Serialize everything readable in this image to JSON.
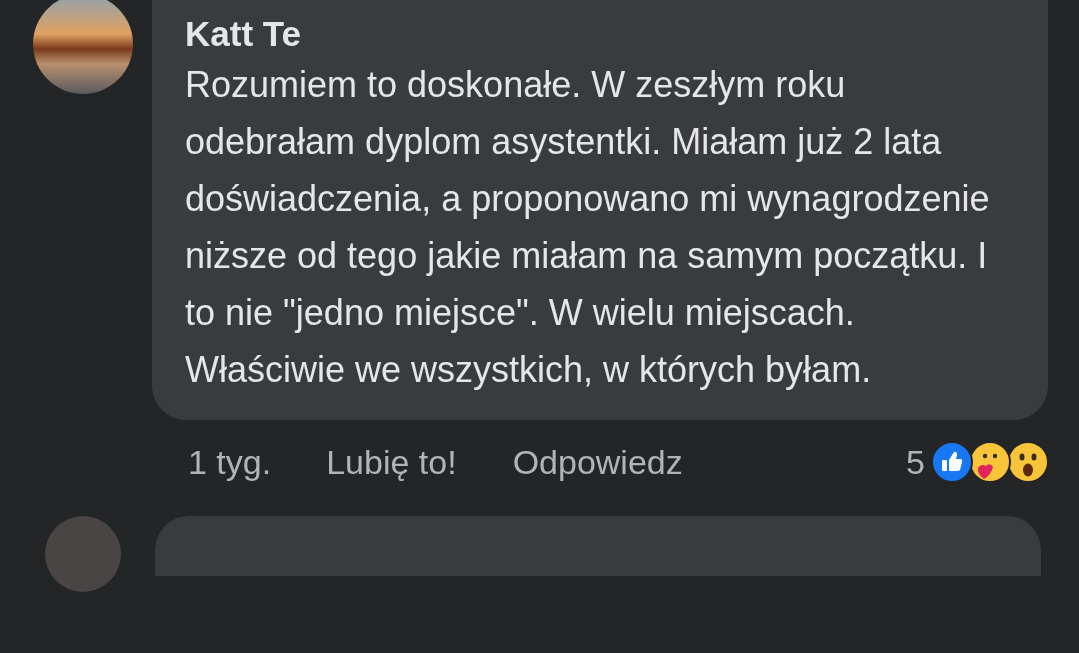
{
  "comment": {
    "author": "Katt Te",
    "text": "Rozumiem to doskonałe. W zeszłym roku odebrałam dyplom asystentki. Miałam już 2 lata doświadczenia, a proponowano mi wynagrodzenie niższe od tego jakie miałam na samym początku. I to nie \"jedno miejsce\". W wielu miejscach. Właściwie we wszystkich, w których byłam.",
    "time": "1 tyg.",
    "like": "Lubię to!",
    "reply": "Odpowiedz",
    "reaction_count": "5"
  }
}
